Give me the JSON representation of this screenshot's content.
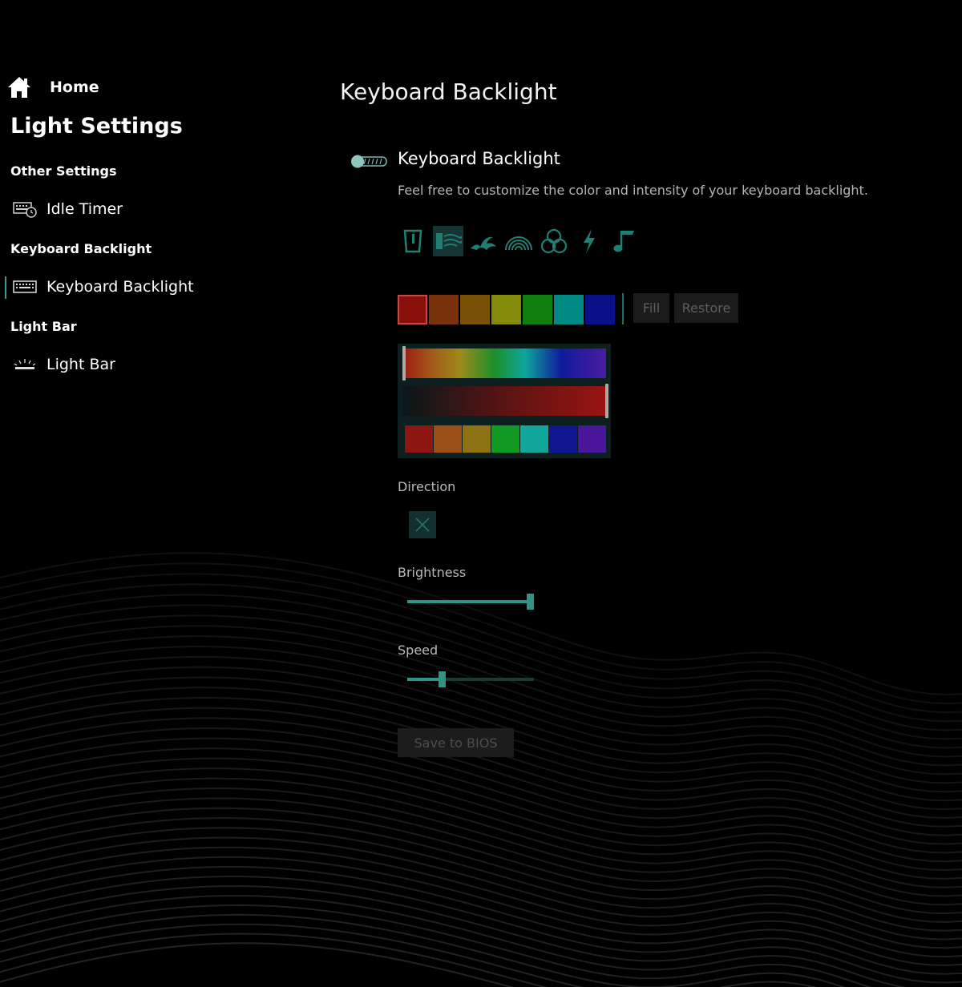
{
  "sidebar": {
    "home_label": "Home",
    "page_heading": "Light Settings",
    "sections": [
      {
        "heading": "Other Settings",
        "items": [
          {
            "label": "Idle Timer",
            "icon": "keyboard-clock-icon"
          }
        ]
      },
      {
        "heading": "Keyboard Backlight",
        "items": [
          {
            "label": "Keyboard Backlight",
            "icon": "keyboard-icon",
            "active": true
          }
        ]
      },
      {
        "heading": "Light Bar",
        "items": [
          {
            "label": "Light Bar",
            "icon": "light-bar-icon"
          }
        ]
      }
    ]
  },
  "main": {
    "title": "Keyboard Backlight",
    "toggle_label": "Keyboard Backlight",
    "toggle_state": "on",
    "description": "Feel free to customize the color and intensity of your keyboard backlight.",
    "effects": [
      {
        "icon": "static-icon",
        "selected": false
      },
      {
        "icon": "breath-wave-icon",
        "selected": true
      },
      {
        "icon": "wave-icon",
        "selected": false
      },
      {
        "icon": "rainbow-icon",
        "selected": false
      },
      {
        "icon": "color-mix-icon",
        "selected": false
      },
      {
        "icon": "lightning-icon",
        "selected": false
      },
      {
        "icon": "music-note-icon",
        "selected": false
      }
    ],
    "zone_colors": [
      "#8a0f0c",
      "#7a320c",
      "#7a4f08",
      "#838a0a",
      "#0f7f12",
      "#008a86",
      "#0b0f8a"
    ],
    "fill_label": "Fill",
    "restore_label": "Restore",
    "preset_colors": [
      "#8e1612",
      "#9a4f18",
      "#8d7214",
      "#109a24",
      "#10a79a",
      "#0f1690",
      "#4a169a"
    ],
    "direction_label": "Direction",
    "brightness_label": "Brightness",
    "brightness_level": 1.0,
    "speed_label": "Speed",
    "speed_level": 0.26,
    "save_label": "Save to BIOS",
    "accent_color": "#2f9484"
  }
}
